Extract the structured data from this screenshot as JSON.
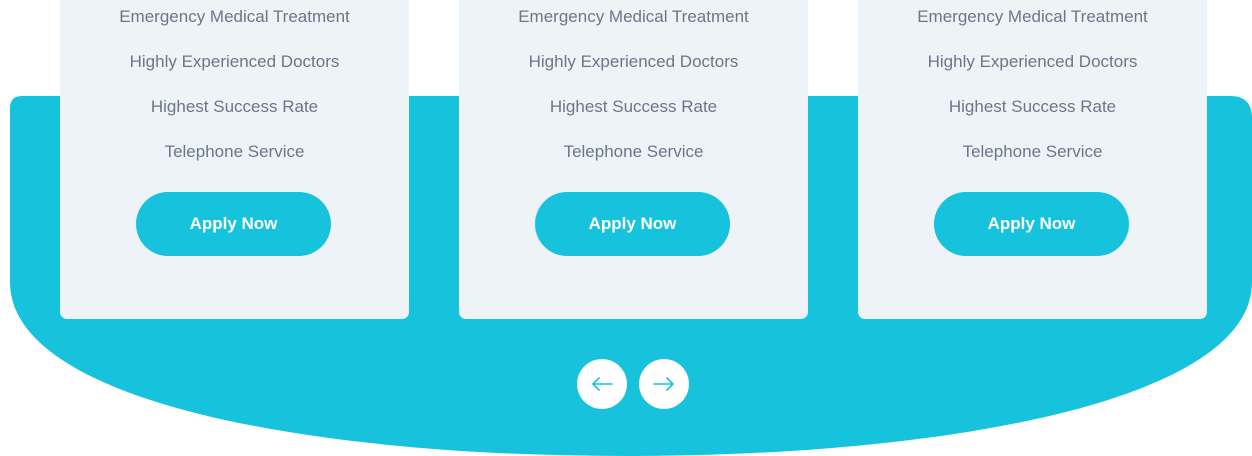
{
  "colors": {
    "accent": "#17c3dc",
    "card_bg": "#eef3f8",
    "feature_text": "#6b7786",
    "button_text": "#ffffff"
  },
  "cards": [
    {
      "features": [
        "Emergency Medical Treatment",
        "Highly Experienced Doctors",
        "Highest Success Rate",
        "Telephone Service"
      ],
      "button_label": "Apply Now"
    },
    {
      "features": [
        "Emergency Medical Treatment",
        "Highly Experienced Doctors",
        "Highest Success Rate",
        "Telephone Service"
      ],
      "button_label": "Apply Now"
    },
    {
      "features": [
        "Emergency Medical Treatment",
        "Highly Experienced Doctors",
        "Highest Success Rate",
        "Telephone Service"
      ],
      "button_label": "Apply Now"
    }
  ],
  "carousel_nav": {
    "prev_icon": "arrow-left-icon",
    "next_icon": "arrow-right-icon"
  }
}
